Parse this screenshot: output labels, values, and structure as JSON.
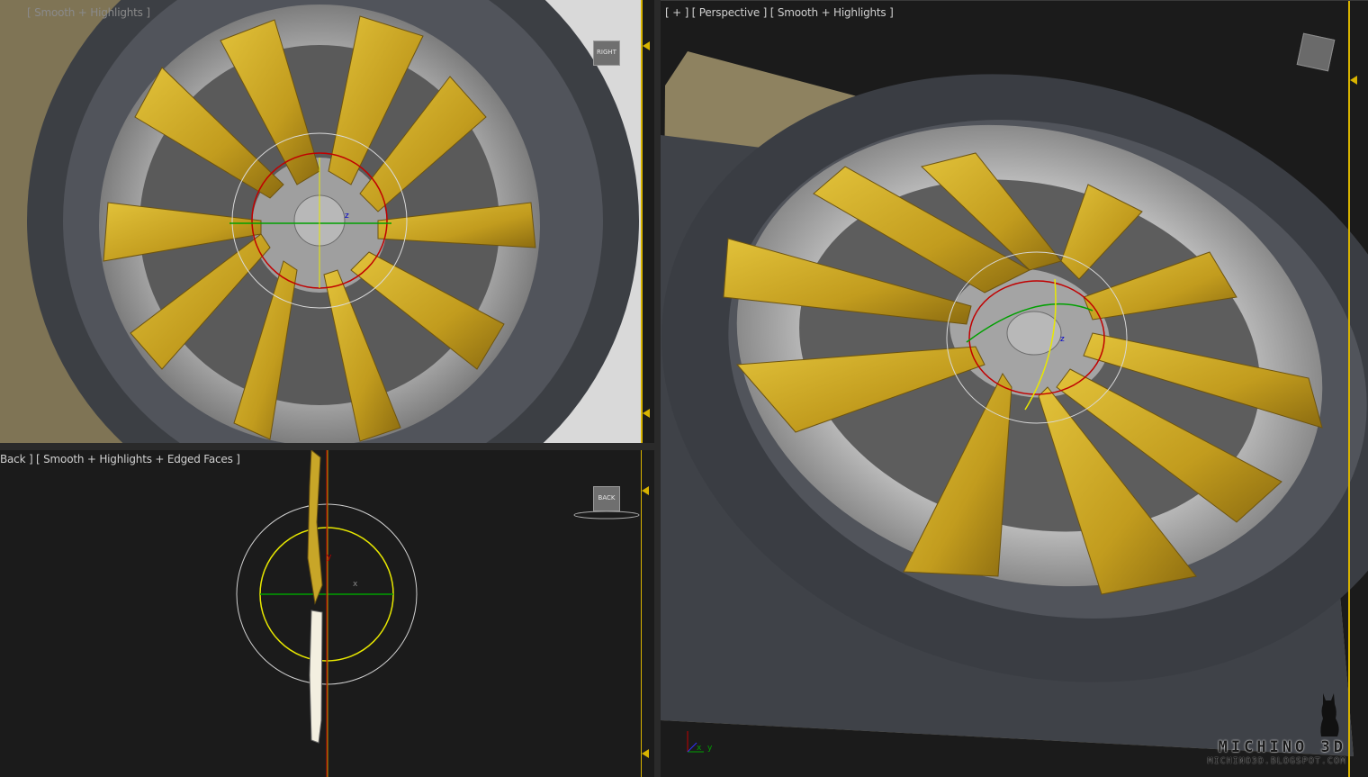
{
  "viewports": {
    "right": {
      "label": "[ Smooth + Highlights ]",
      "viewcube_label": "RIGHT"
    },
    "perspective": {
      "label": "[ + ] [ Perspective ] [ Smooth + Highlights ]"
    },
    "back": {
      "label": "Back ] [ Smooth + Highlights + Edged Faces ]",
      "viewcube_label": "BACK"
    }
  },
  "gizmo": {
    "axis_x": "x",
    "axis_y": "y",
    "axis_z": "z"
  },
  "watermark": {
    "title": "MICHINO 3D",
    "url": "MICHINO3D.BLOGSPOT.COM"
  },
  "colors": {
    "viewport_bg": "#1b1b1b",
    "active_border": "#d8b300",
    "spoke_gold": "#c8a628",
    "rotate_red": "#c00000",
    "rotate_green": "#00a000",
    "selection_yellow": "#e8e800"
  },
  "icons": [
    "cat-silhouette-icon",
    "viewcube-icon",
    "axis-tripod-icon"
  ]
}
